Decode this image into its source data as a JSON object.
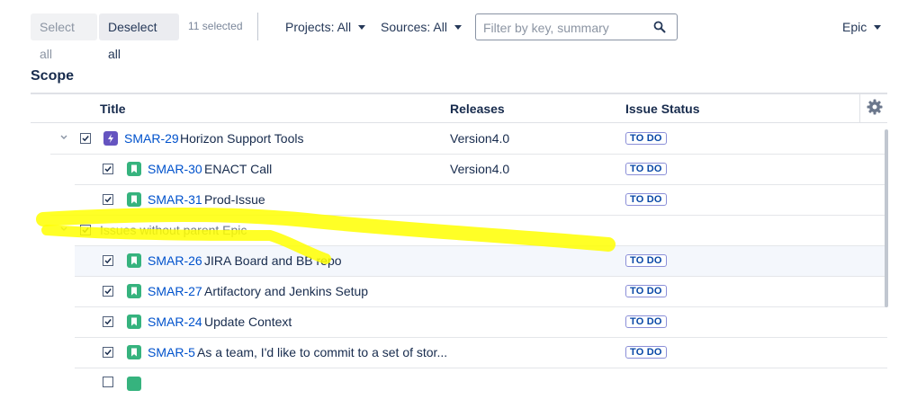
{
  "toolbar": {
    "select_all": "Select all",
    "deselect_all": "Deselect all",
    "selected_count": "11 selected",
    "projects_filter": "Projects: All",
    "sources_filter": "Sources: All",
    "search_placeholder": "Filter by key, summary",
    "group_by": "Epic"
  },
  "scope": {
    "heading": "Scope",
    "columns": {
      "title": "Title",
      "releases": "Releases",
      "status": "Issue Status"
    },
    "rows": [
      {
        "level": 0,
        "type": "epic",
        "key": "SMAR-29",
        "summary": "Horizon Support Tools",
        "release": "Version4.0",
        "status": "TO DO",
        "checked": true
      },
      {
        "level": 1,
        "type": "story",
        "key": "SMAR-30",
        "summary": "ENACT Call",
        "release": "Version4.0",
        "status": "TO DO",
        "checked": true
      },
      {
        "level": 1,
        "type": "story",
        "key": "SMAR-31",
        "summary": "Prod-Issue",
        "release": "",
        "status": "TO DO",
        "checked": true
      },
      {
        "level": 0,
        "type": "group",
        "label": "Issues without parent Epic",
        "checked": true
      },
      {
        "level": 1,
        "type": "story",
        "key": "SMAR-26",
        "summary": "JIRA Board and BB repo",
        "release": "",
        "status": "TO DO",
        "checked": true
      },
      {
        "level": 1,
        "type": "story",
        "key": "SMAR-27",
        "summary": "Artifactory and Jenkins Setup",
        "release": "",
        "status": "TO DO",
        "checked": true
      },
      {
        "level": 1,
        "type": "story",
        "key": "SMAR-24",
        "summary": "Update Context",
        "release": "",
        "status": "TO DO",
        "checked": true
      },
      {
        "level": 1,
        "type": "story",
        "key": "SMAR-5",
        "summary": "As a team, I'd like to commit to a set of stor...",
        "release": "",
        "status": "TO DO",
        "checked": true
      }
    ]
  },
  "colors": {
    "link": "#0052cc",
    "epic": "#6554c0",
    "story": "#36b37e",
    "highlight": "#ffff00"
  }
}
